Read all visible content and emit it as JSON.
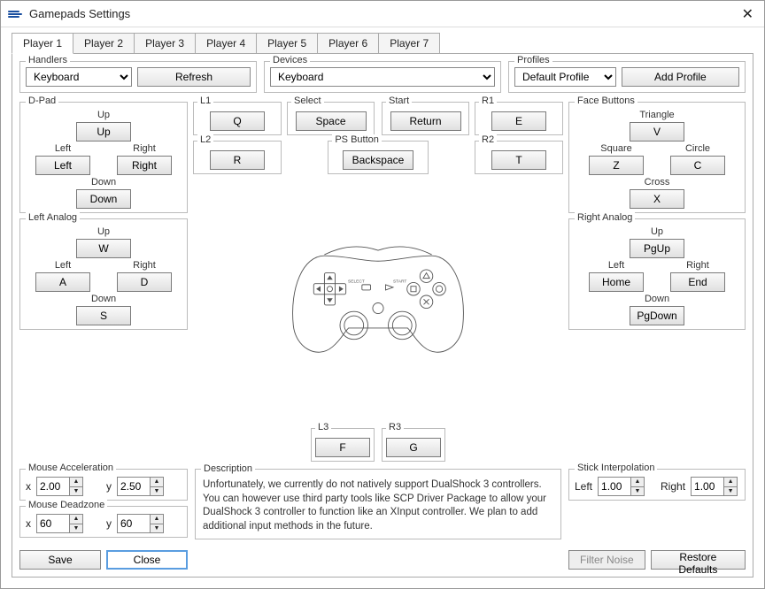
{
  "window": {
    "title": "Gamepads Settings"
  },
  "tabs": [
    "Player 1",
    "Player 2",
    "Player 3",
    "Player 4",
    "Player 5",
    "Player 6",
    "Player 7"
  ],
  "active_tab": 0,
  "handlers": {
    "label": "Handlers",
    "selected": "Keyboard",
    "refresh": "Refresh"
  },
  "devices": {
    "label": "Devices",
    "selected": "Keyboard"
  },
  "profiles": {
    "label": "Profiles",
    "selected": "Default Profile",
    "add": "Add Profile"
  },
  "dpad": {
    "label": "D-Pad",
    "up": {
      "lbl": "Up",
      "val": "Up"
    },
    "down": {
      "lbl": "Down",
      "val": "Down"
    },
    "left": {
      "lbl": "Left",
      "val": "Left"
    },
    "right": {
      "lbl": "Right",
      "val": "Right"
    }
  },
  "leftanalog": {
    "label": "Left Analog",
    "up": {
      "lbl": "Up",
      "val": "W"
    },
    "down": {
      "lbl": "Down",
      "val": "S"
    },
    "left": {
      "lbl": "Left",
      "val": "A"
    },
    "right": {
      "lbl": "Right",
      "val": "D"
    }
  },
  "rightanalog": {
    "label": "Right Analog",
    "up": {
      "lbl": "Up",
      "val": "PgUp"
    },
    "down": {
      "lbl": "Down",
      "val": "PgDown"
    },
    "left": {
      "lbl": "Left",
      "val": "Home"
    },
    "right": {
      "lbl": "Right",
      "val": "End"
    }
  },
  "l1": {
    "label": "L1",
    "val": "Q"
  },
  "l2": {
    "label": "L2",
    "val": "R"
  },
  "r1": {
    "label": "R1",
    "val": "E"
  },
  "r2": {
    "label": "R2",
    "val": "T"
  },
  "select": {
    "label": "Select",
    "val": "Space"
  },
  "start": {
    "label": "Start",
    "val": "Return"
  },
  "psbutton": {
    "label": "PS Button",
    "val": "Backspace"
  },
  "l3": {
    "label": "L3",
    "val": "F"
  },
  "r3": {
    "label": "R3",
    "val": "G"
  },
  "face": {
    "label": "Face Buttons",
    "triangle": {
      "lbl": "Triangle",
      "val": "V"
    },
    "square": {
      "lbl": "Square",
      "val": "Z"
    },
    "circle": {
      "lbl": "Circle",
      "val": "C"
    },
    "cross": {
      "lbl": "Cross",
      "val": "X"
    }
  },
  "mouse_accel": {
    "label": "Mouse Acceleration",
    "xlbl": "x",
    "ylbl": "y",
    "x": "2.00",
    "y": "2.50"
  },
  "mouse_dead": {
    "label": "Mouse Deadzone",
    "xlbl": "x",
    "ylbl": "y",
    "x": "60",
    "y": "60"
  },
  "stick_interp": {
    "label": "Stick Interpolation",
    "leftlbl": "Left",
    "rightlbl": "Right",
    "left": "1.00",
    "right": "1.00"
  },
  "description": {
    "label": "Description",
    "text": "Unfortunately, we currently do not natively support DualShock 3 controllers. You can however use third party tools like SCP Driver Package to allow your DualShock 3 controller to function like an XInput controller. We plan to add additional input methods in the future."
  },
  "footer": {
    "save": "Save",
    "close": "Close",
    "filter": "Filter Noise",
    "restore": "Restore Defaults"
  },
  "controller_labels": {
    "select": "SELECT",
    "start": "START"
  }
}
